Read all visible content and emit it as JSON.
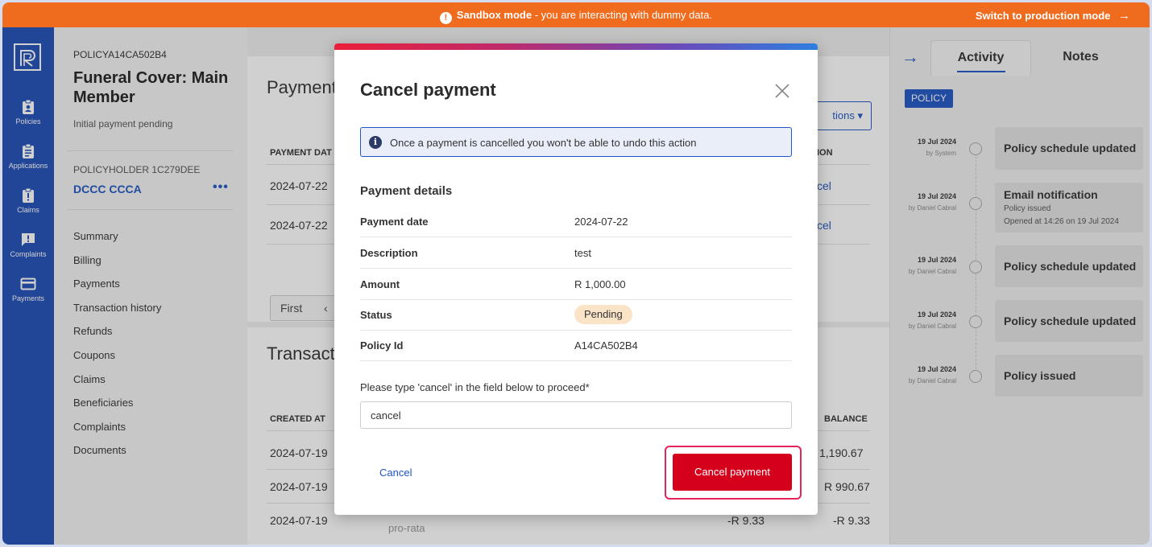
{
  "banner": {
    "icon": "warning-icon",
    "mode_label": "Sandbox mode",
    "message": " - you are interacting with dummy data.",
    "switch_label": "Switch to production mode",
    "switch_arrow": "→"
  },
  "nav": {
    "items": [
      {
        "label": "Policies",
        "icon": "policy-clipboard-icon"
      },
      {
        "label": "Applications",
        "icon": "clipboard-list-icon"
      },
      {
        "label": "Claims",
        "icon": "clipboard-alert-icon"
      },
      {
        "label": "Complaints",
        "icon": "chat-alert-icon"
      },
      {
        "label": "Payments",
        "icon": "credit-card-icon"
      }
    ]
  },
  "policy": {
    "code": "POLICYA14CA502B4",
    "title": "Funeral Cover: Main Member",
    "status": "Initial payment pending",
    "holder_label": "POLICYHOLDER 1C279DEE",
    "holder_name": "DCCC CCCA",
    "more": "•••",
    "menu": [
      "Summary",
      "Billing",
      "Payments",
      "Transaction history",
      "Refunds",
      "Coupons",
      "Claims",
      "Beneficiaries",
      "Complaints",
      "Documents"
    ]
  },
  "payments_card": {
    "title": "Payment",
    "actions_label": "tions ▾",
    "col_date": "PAYMENT DAT",
    "col_action": "ION",
    "rows": [
      {
        "date": "2024-07-22",
        "action": "cel"
      },
      {
        "date": "2024-07-22",
        "action": "cel"
      }
    ],
    "pager_first": "First",
    "pager_prev": "‹"
  },
  "transactions_card": {
    "title": "Transact",
    "col_created": "CREATED AT",
    "col_balance": "BALANCE",
    "rows": [
      {
        "date": "2024-07-19",
        "amount": "",
        "balance": "1,190.67"
      },
      {
        "date": "2024-07-19",
        "amount": "",
        "balance": "R 990.67"
      },
      {
        "date": "2024-07-19",
        "amount": "-R 9.33",
        "balance": "-R 9.33"
      }
    ],
    "pro_rata": "pro-rata"
  },
  "activity": {
    "arrow": "→",
    "tabs": [
      "Activity",
      "Notes"
    ],
    "badge": "POLICY",
    "events": [
      {
        "date": "19 Jul 2024",
        "by": "by System",
        "title": "Policy schedule updated",
        "sub1": "",
        "sub2": ""
      },
      {
        "date": "19 Jul 2024",
        "by": "by Daniel Cabral",
        "title": "Email notification",
        "sub1": "Policy issued",
        "sub2": "Opened at 14:26 on 19 Jul 2024"
      },
      {
        "date": "19 Jul 2024",
        "by": "by Daniel Cabral",
        "title": "Policy schedule updated",
        "sub1": "",
        "sub2": ""
      },
      {
        "date": "19 Jul 2024",
        "by": "by Daniel Cabral",
        "title": "Policy schedule updated",
        "sub1": "",
        "sub2": ""
      },
      {
        "date": "19 Jul 2024",
        "by": "by Daniel Cabral",
        "title": "Policy issued",
        "sub1": "",
        "sub2": ""
      }
    ]
  },
  "modal": {
    "title": "Cancel payment",
    "info_icon": "i",
    "info_text": "Once a payment is cancelled you won't be able to undo this action",
    "details_title": "Payment details",
    "rows": [
      {
        "label": "Payment date",
        "value": "2024-07-22"
      },
      {
        "label": "Description",
        "value": "test"
      },
      {
        "label": "Amount",
        "value": "R 1,000.00"
      },
      {
        "label": "Status",
        "value": "Pending"
      },
      {
        "label": "Policy Id",
        "value": "A14CA502B4"
      }
    ],
    "confirm_label": "Please type 'cancel' in the field below to proceed*",
    "confirm_value": "cancel",
    "cancel_label": "Cancel",
    "submit_label": "Cancel payment"
  },
  "colors": {
    "banner": "#ef6c1f",
    "nav": "#1f4fb6",
    "link": "#1f56c4",
    "danger": "#d5001b",
    "pending_pill": "#fbe3c8"
  }
}
